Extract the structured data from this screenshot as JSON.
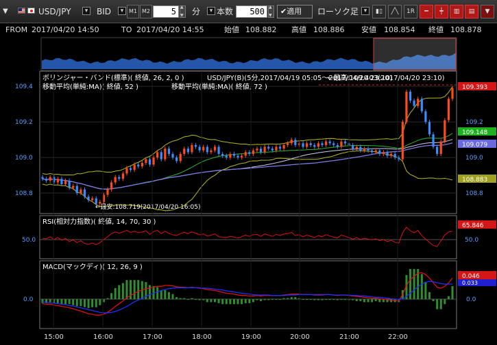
{
  "toolbar": {
    "symbol": "USD/JPY",
    "side": "BID",
    "m1_label": "M1",
    "m2_label": "M2",
    "interval_value": "5",
    "interval_unit": "分",
    "count_label": "本数",
    "count_value": "500",
    "apply_label": "適用",
    "chart_type": "ローソク足",
    "btn_1r": "1R"
  },
  "info": {
    "from_label": "FROM",
    "from_value": "2017/04/20 14:50",
    "to_label": "TO",
    "to_value": "2017/04/20 14:55",
    "open_label": "始値",
    "open_value": "108.882",
    "high_label": "高値",
    "high_value": "108.886",
    "low_label": "安値",
    "low_value": "108.854",
    "close_label": "終値",
    "close_value": "108.878"
  },
  "chart_data": {
    "type": "candlestick",
    "price_ticks": [
      "109.4",
      "109.2",
      "109.0",
      "108.8"
    ],
    "price_tick_values": [
      109.4,
      109.2,
      109.0,
      108.8
    ],
    "ylim": [
      108.7,
      109.47
    ],
    "x_ticks": [
      "15:00",
      "16:00",
      "17:00",
      "18:00",
      "19:00",
      "20:00",
      "21:00",
      "22:00"
    ],
    "legend": {
      "bollinger": "ボリンジャー・バンド(標準)( 終値, 26, 2, 0 )",
      "ma52": "移動平均(単純:MA)( 終値, 52 )",
      "ma72": "移動平均(単純:MA)( 終値, 72 )",
      "header": "USD/JPY(B)(5分,2017/04/19 05:05〜2017/04/20 23:10)",
      "high_note": "←最高:109.403(2017/04/20 23:10)",
      "low_note": "←最安:108.719(2017/04/20 16:05)"
    },
    "right_labels": {
      "close": "109.393",
      "bb_upper": "109.148",
      "ma": "109.079",
      "bb_lower": "108.883"
    },
    "close_values": [
      108.88,
      108.87,
      108.89,
      108.86,
      108.88,
      108.85,
      108.87,
      108.83,
      108.84,
      108.8,
      108.82,
      108.78,
      108.76,
      108.77,
      108.74,
      108.75,
      108.79,
      108.82,
      108.86,
      108.89,
      108.88,
      108.91,
      108.94,
      108.93,
      108.96,
      108.95,
      108.97,
      108.99,
      108.96,
      109.0,
      109.03,
      108.99,
      109.05,
      109.02,
      109.0,
      108.98,
      109.02,
      109.05,
      109.03,
      109.07,
      109.06,
      109.04,
      109.06,
      109.03,
      109.04,
      109.06,
      109.02,
      109.01,
      109.0,
      109.02,
      109.01,
      109.0,
      109.01,
      109.03,
      109.02,
      109.04,
      109.05,
      109.03,
      109.06,
      109.05,
      109.04,
      109.06,
      109.05,
      109.07,
      109.08,
      109.1,
      109.07,
      109.08,
      109.06,
      109.08,
      109.07,
      109.06,
      109.08,
      109.07,
      109.09,
      109.08,
      109.07,
      109.06,
      109.09,
      109.08,
      109.07,
      109.05,
      109.06,
      109.04,
      109.05,
      109.04,
      109.03,
      109.04,
      109.02,
      109.03,
      109.01,
      109.02,
      109.0,
      108.99,
      109.2,
      109.37,
      109.32,
      109.29,
      109.33,
      109.26,
      109.2,
      109.13,
      109.06,
      109.02,
      109.09,
      109.21,
      109.33,
      109.39
    ],
    "rsi": {
      "label": "RSI(相対力指数)( 終値, 14, 70, 30 )",
      "tick": "50.0",
      "right_label": "65.846",
      "values": [
        48,
        47,
        52,
        45,
        50,
        43,
        48,
        40,
        44,
        37,
        42,
        35,
        33,
        36,
        32,
        37,
        45,
        52,
        60,
        64,
        61,
        64,
        68,
        63,
        66,
        62,
        64,
        67,
        58,
        65,
        68,
        60,
        66,
        60,
        57,
        55,
        60,
        63,
        60,
        64,
        61,
        57,
        59,
        54,
        56,
        59,
        52,
        51,
        50,
        53,
        51,
        49,
        52,
        56,
        53,
        57,
        58,
        53,
        59,
        56,
        53,
        58,
        55,
        59,
        60,
        63,
        55,
        57,
        52,
        56,
        53,
        50,
        55,
        52,
        57,
        54,
        51,
        49,
        56,
        53,
        50,
        46,
        50,
        45,
        48,
        46,
        44,
        47,
        42,
        45,
        40,
        43,
        38,
        36,
        62,
        76,
        67,
        62,
        68,
        55,
        46,
        38,
        30,
        27,
        42,
        56,
        64,
        66
      ]
    },
    "macd": {
      "label": "MACD(マックディ)( 12, 26, 9 )",
      "tick": "0.0",
      "right_labels": [
        "0.046",
        "0.033"
      ],
      "macd": [
        -0.01,
        -0.011,
        -0.011,
        -0.013,
        -0.014,
        -0.016,
        -0.017,
        -0.019,
        -0.021,
        -0.024,
        -0.026,
        -0.029,
        -0.032,
        -0.033,
        -0.035,
        -0.035,
        -0.033,
        -0.029,
        -0.023,
        -0.016,
        -0.01,
        -0.004,
        0.003,
        0.008,
        0.013,
        0.017,
        0.02,
        0.023,
        0.024,
        0.026,
        0.028,
        0.028,
        0.03,
        0.03,
        0.029,
        0.027,
        0.026,
        0.026,
        0.025,
        0.026,
        0.025,
        0.024,
        0.023,
        0.021,
        0.02,
        0.019,
        0.017,
        0.015,
        0.013,
        0.012,
        0.011,
        0.009,
        0.008,
        0.008,
        0.007,
        0.007,
        0.008,
        0.007,
        0.008,
        0.008,
        0.008,
        0.008,
        0.008,
        0.009,
        0.01,
        0.011,
        0.011,
        0.011,
        0.01,
        0.01,
        0.01,
        0.009,
        0.009,
        0.009,
        0.01,
        0.01,
        0.009,
        0.008,
        0.009,
        0.009,
        0.008,
        0.007,
        0.006,
        0.005,
        0.004,
        0.003,
        0.002,
        0.002,
        0.001,
        0.0,
        -0.001,
        -0.002,
        -0.003,
        -0.004,
        0.01,
        0.03,
        0.043,
        0.05,
        0.057,
        0.058,
        0.054,
        0.046,
        0.036,
        0.026,
        0.024,
        0.028,
        0.036,
        0.046
      ],
      "signal": [
        -0.006,
        -0.007,
        -0.008,
        -0.009,
        -0.01,
        -0.011,
        -0.012,
        -0.014,
        -0.015,
        -0.017,
        -0.019,
        -0.021,
        -0.023,
        -0.025,
        -0.027,
        -0.029,
        -0.03,
        -0.03,
        -0.029,
        -0.027,
        -0.024,
        -0.02,
        -0.016,
        -0.011,
        -0.006,
        -0.002,
        0.002,
        0.006,
        0.01,
        0.013,
        0.016,
        0.019,
        0.021,
        0.023,
        0.024,
        0.025,
        0.025,
        0.025,
        0.025,
        0.025,
        0.025,
        0.025,
        0.024,
        0.024,
        0.023,
        0.022,
        0.021,
        0.02,
        0.018,
        0.017,
        0.016,
        0.014,
        0.013,
        0.012,
        0.011,
        0.01,
        0.009,
        0.009,
        0.009,
        0.009,
        0.008,
        0.008,
        0.008,
        0.008,
        0.009,
        0.009,
        0.009,
        0.01,
        0.01,
        0.01,
        0.01,
        0.01,
        0.01,
        0.01,
        0.01,
        0.01,
        0.009,
        0.009,
        0.009,
        0.009,
        0.009,
        0.008,
        0.008,
        0.007,
        0.007,
        0.006,
        0.005,
        0.004,
        0.004,
        0.003,
        0.002,
        0.001,
        0.0,
        -0.001,
        0.001,
        0.006,
        0.013,
        0.02,
        0.027,
        0.033,
        0.037,
        0.039,
        0.038,
        0.036,
        0.034,
        0.033,
        0.033,
        0.033
      ]
    }
  },
  "colors": {
    "up": "#ff4a1a",
    "down": "#3c8cff",
    "bb_outer": "#b8b820",
    "bb_mid": "#2fb52f",
    "ma52": "#d0d0f0",
    "ma72": "#7b7be0",
    "rsi": "#e01010",
    "macd": "#e01010",
    "signal": "#2030ff",
    "hist": "#2f8f2f",
    "navigator": "#2a66c8"
  }
}
